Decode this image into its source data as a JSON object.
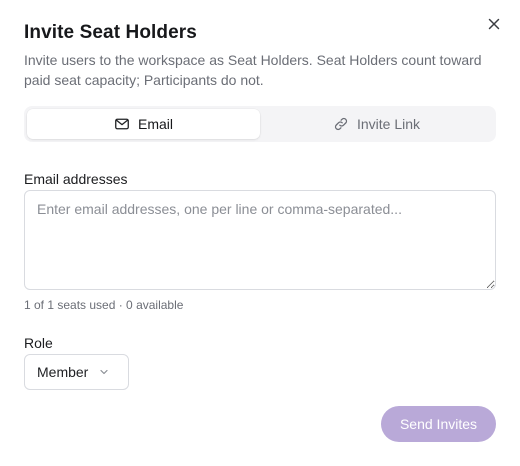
{
  "dialog": {
    "title": "Invite Seat Holders",
    "description": "Invite users to the workspace as Seat Holders. Seat Holders count toward paid seat capacity; Participants do not.",
    "close_icon": "close-icon"
  },
  "tabs": [
    {
      "label": "Email",
      "icon": "mail-icon",
      "active": true
    },
    {
      "label": "Invite Link",
      "icon": "link-icon",
      "active": false
    }
  ],
  "email_field": {
    "label": "Email addresses",
    "value": "",
    "placeholder": "Enter email addresses, one per line or comma-separated..."
  },
  "seats_note": "1 of 1 seats used · 0 available",
  "role": {
    "label": "Role",
    "selected": "Member",
    "icon": "chevron-down-icon"
  },
  "actions": {
    "send_label": "Send Invites",
    "send_color": "#b9a9d8",
    "send_disabled": true
  }
}
